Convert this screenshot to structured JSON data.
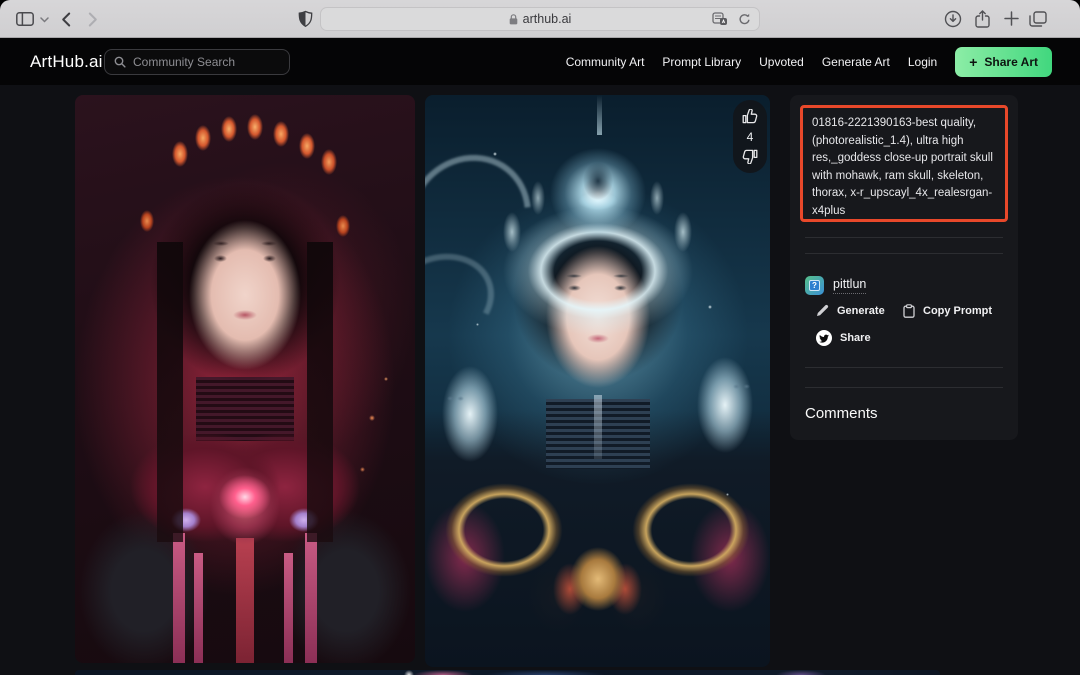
{
  "browser": {
    "url": "arthub.ai"
  },
  "nav": {
    "logo": "ArtHub.ai",
    "search_placeholder": "Community Search",
    "links": [
      "Community Art",
      "Prompt Library",
      "Upvoted",
      "Generate Art",
      "Login"
    ],
    "share_button": "Share Art",
    "share_plus": "+"
  },
  "post": {
    "prompt": "01816-2221390163-best quality, (photorealistic_1.4), ultra high res,_goddess close-up portrait skull with mohawk, ram skull, skeleton, thorax, x-r_upscayl_4x_realesrgan-x4plus",
    "upvotes": "4",
    "author": "pittlun",
    "avatar_glyph": "?",
    "actions": {
      "generate": "Generate",
      "copy_prompt": "Copy Prompt",
      "share": "Share"
    },
    "comments_title": "Comments"
  },
  "icons": {
    "browser": [
      "sidebar",
      "chevron-down",
      "back",
      "forward",
      "shield",
      "lock",
      "page-settings",
      "reload",
      "download",
      "share",
      "new-tab",
      "tab-overview"
    ],
    "site": [
      "search",
      "plus",
      "thumbs-up",
      "thumbs-down",
      "pencil",
      "clipboard",
      "twitter-bird"
    ]
  },
  "colors": {
    "accent_green_start": "#8ceda6",
    "accent_green_end": "#41d77e",
    "prompt_highlight_border": "#e8482a",
    "panel_bg": "#17181c",
    "page_bg": "#0f1014",
    "chrome_bg": "#d3d2d4"
  }
}
